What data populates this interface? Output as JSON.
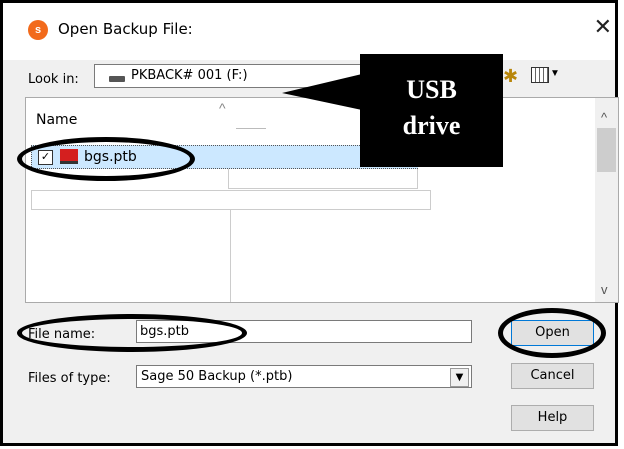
{
  "window": {
    "title": "Open Backup File:",
    "app_icon_glyph": "⭘",
    "close_glyph": "✕"
  },
  "lookin": {
    "label": "Look in:",
    "value": "PKBACK# 001 (F:)"
  },
  "filelist": {
    "column_header": "Name",
    "files": [
      {
        "name": "bgs.ptb",
        "selected": true
      }
    ]
  },
  "filename": {
    "label": "File name:",
    "value": "bgs.ptb"
  },
  "filetype": {
    "label": "Files of type:",
    "value": "Sage 50 Backup (*.ptb)"
  },
  "buttons": {
    "open": "Open",
    "cancel": "Cancel",
    "help": "Help"
  },
  "annotation": {
    "line1": "USB",
    "line2": "drive"
  },
  "colors": {
    "accent": "#f26a1b",
    "selection": "#cce8ff",
    "focus": "#0078d7"
  }
}
